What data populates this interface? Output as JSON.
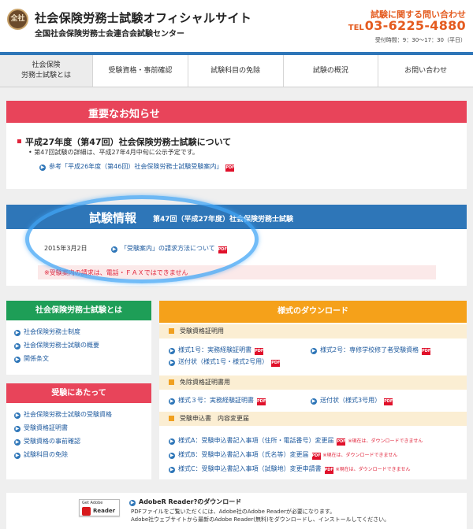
{
  "header": {
    "logo_text": "全社",
    "title": "社会保険労務士試験オフィシャルサイト",
    "subtitle": "全国社会保険労務士会連合会試験センター",
    "contact_title": "試験に関する問い合わせ",
    "tel_label": "TEL",
    "tel": "03-6225-4880",
    "hours": "受付時間：9：30〜17：30（平日）"
  },
  "nav": [
    "社会保険\n労務士試験とは",
    "受験資格・事前確認",
    "試験科目の免除",
    "試験の概況",
    "お問い合わせ"
  ],
  "notice": {
    "heading": "重要なお知らせ",
    "title": "平成27年度（第47回）社会保険労務士試験について",
    "bullet": "第47回試験の詳細は、平成27年4月中旬に公示予定です。",
    "link": "参考「平成26年度（第46回）社会保険労務士試験受験案内」"
  },
  "exam": {
    "heading": "試験情報",
    "subheading": "第47回（平成27年度）社会保険労務士試験",
    "date": "2015年3月2日",
    "link": "「受験案内」の請求方法について",
    "note": "※受験案内の請求は、電話・ＦＡＸではできません"
  },
  "about": {
    "heading": "社会保険労務士試験とは",
    "items": [
      "社会保険労務士制度",
      "社会保険労務士試験の概要",
      "関係条文"
    ]
  },
  "apply": {
    "heading": "受験にあたって",
    "items": [
      "社会保険労務士試験の受験資格",
      "受験資格証明書",
      "受験資格の事前確認",
      "試験科目の免除"
    ]
  },
  "download": {
    "heading": "様式のダウンロード",
    "sections": [
      {
        "title": "受験資格証明用",
        "items": [
          "様式1号：実務経験証明書",
          "様式2号：専修学校修了者受験資格",
          "送付状（様式1号・様式2号用）"
        ]
      },
      {
        "title": "免除資格証明書用",
        "items": [
          "様式３号：実務経験証明書",
          "送付状（様式3号用）"
        ]
      },
      {
        "title": "受験申込書　内容変更届",
        "items": [
          "様式A：受験申込書記入事項（住所・電話番号）変更届",
          "様式B：受験申込書記入事項（氏名等）変更届",
          "様式C：受験申込書記入事項（試験地）変更申請書"
        ]
      }
    ],
    "note": "※現在は、ダウンロードできません"
  },
  "pdf_label": "PDF",
  "adobe": {
    "badge_get": "Get Adobe",
    "badge_reader": "Reader",
    "title": "AdobeR Reader?のダウンロード",
    "line1": "PDFファイルをご覧いただくには、Adobe社のAdobe Readerが必要になります。",
    "line2": "Adobe社ウェブサイトから最新のAdobe Reader(無料)をダウンロードし、インストールしてください。"
  },
  "colors": {
    "nav_accent": "#2e76b8",
    "notice": "#e8445a",
    "exam": "#2e76b8",
    "about": "#1e9e57",
    "download": "#f5a11a",
    "link": "#1e5a9e",
    "tel": "#e45b1f"
  }
}
